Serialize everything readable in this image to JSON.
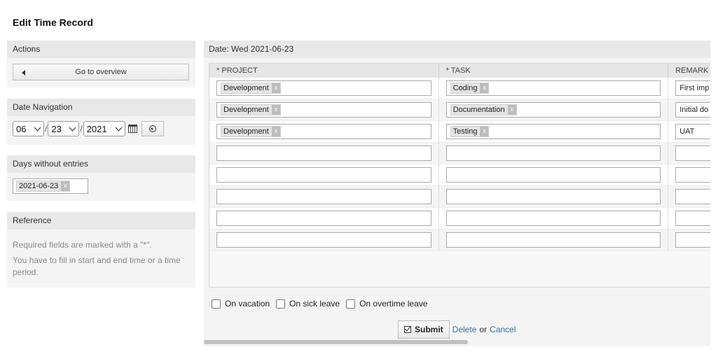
{
  "page_title": "Edit Time Record",
  "sidebar": {
    "actions": {
      "title": "Actions",
      "overview_label": "Go to overview"
    },
    "date_navigation": {
      "title": "Date Navigation",
      "month": "06",
      "day": "23",
      "year": "2021",
      "separator": "/"
    },
    "days_without_entries": {
      "title": "Days without entries",
      "tags": [
        "2021-06-23"
      ]
    },
    "reference": {
      "title": "Reference",
      "lines": [
        "Required fields are marked with a \"*\".",
        "You have to fill in start and end time or a time period."
      ]
    }
  },
  "main": {
    "header": "Date: Wed 2021-06-23",
    "columns": [
      "* PROJECT",
      "* TASK",
      "REMARK"
    ],
    "rows": [
      {
        "project": "Development",
        "task": "Coding",
        "remark": "First imp"
      },
      {
        "project": "Development",
        "task": "Documentation",
        "remark": "Initial do"
      },
      {
        "project": "Development",
        "task": "Testing",
        "remark": "UAT"
      },
      {
        "project": "",
        "task": "",
        "remark": ""
      },
      {
        "project": "",
        "task": "",
        "remark": ""
      },
      {
        "project": "",
        "task": "",
        "remark": ""
      },
      {
        "project": "",
        "task": "",
        "remark": ""
      },
      {
        "project": "",
        "task": "",
        "remark": ""
      }
    ],
    "tag_remove": "x",
    "checkboxes": [
      "On vacation",
      "On sick leave",
      "On overtime leave"
    ],
    "submit_label": "Submit",
    "delete_label": "Delete",
    "or_label": "or",
    "cancel_label": "Cancel"
  }
}
